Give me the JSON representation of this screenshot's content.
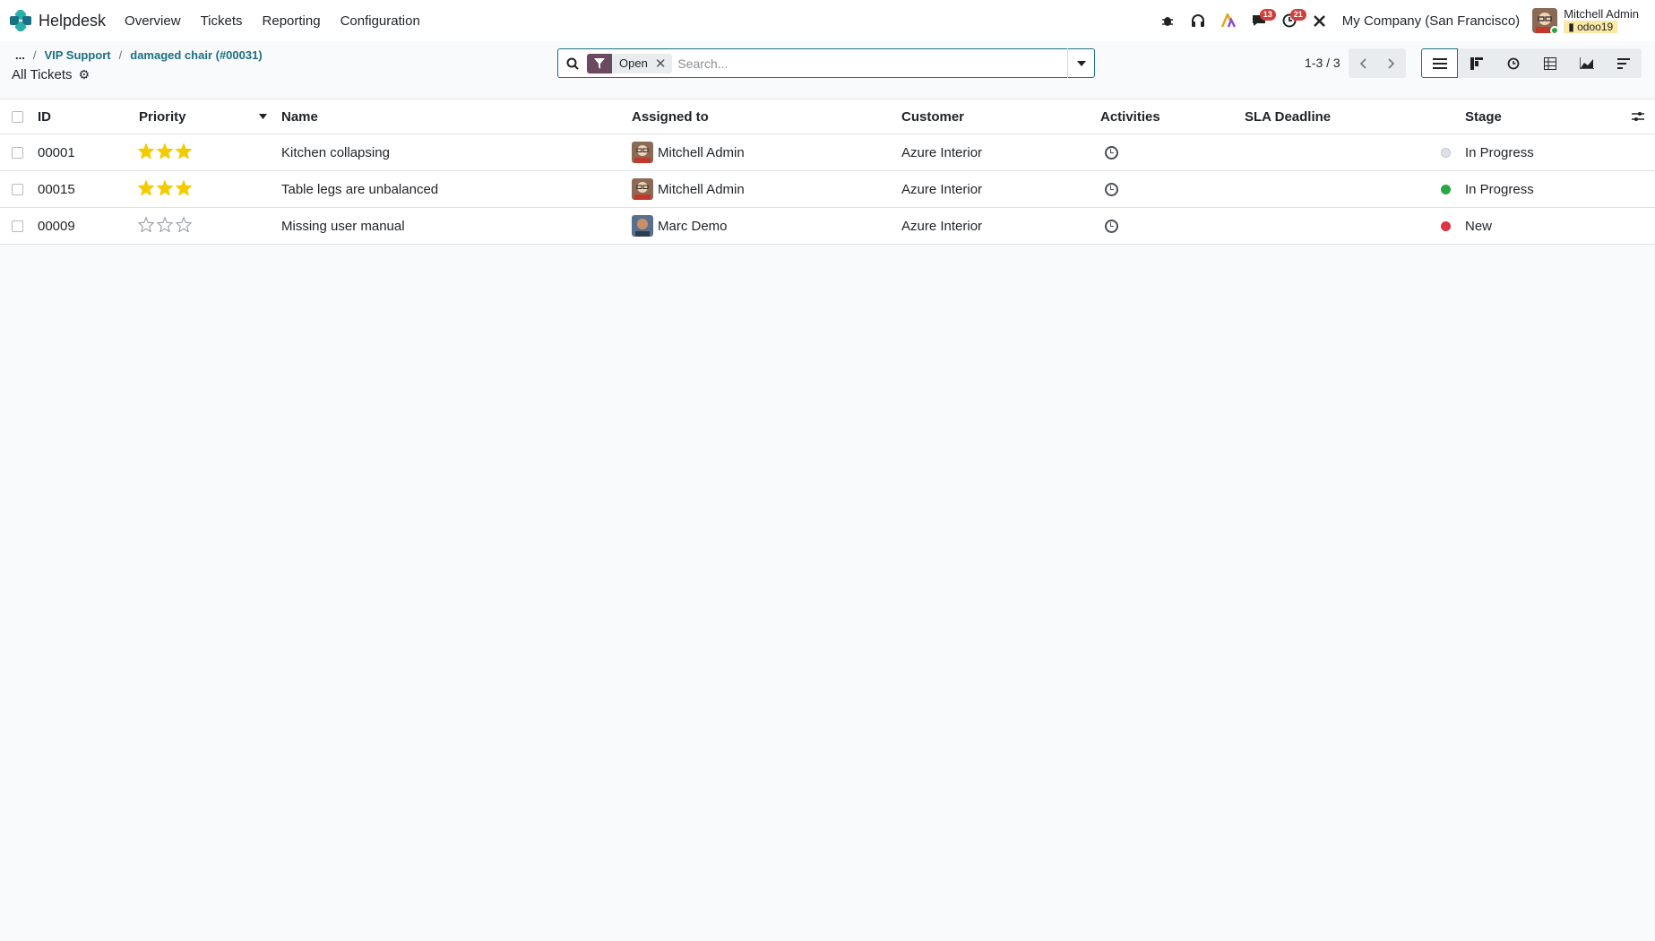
{
  "navbar": {
    "app_name": "Helpdesk",
    "menu": [
      "Overview",
      "Tickets",
      "Reporting",
      "Configuration"
    ],
    "badges": {
      "messages": "13",
      "activities": "21"
    },
    "company": "My Company (San Francisco)",
    "user_name": "Mitchell Admin",
    "db_name": "odoo19",
    "icons": [
      "bug-icon",
      "headset-icon",
      "ai-icon",
      "chat-icon",
      "clock-icon",
      "tools-icon"
    ]
  },
  "breadcrumb": {
    "ellipsis": "...",
    "items": [
      "VIP Support",
      "damaged chair (#00031)"
    ]
  },
  "page_title": "All Tickets",
  "search": {
    "facet_value": "Open",
    "placeholder": "Search..."
  },
  "pager": {
    "text": "1-3 / 3"
  },
  "views": [
    "list",
    "kanban",
    "activity",
    "pivot",
    "graph",
    "cohort"
  ],
  "colors": {
    "accent": "#1b6f82",
    "star": "#f3cc00",
    "dot_green": "#28a745",
    "dot_red": "#dc3545",
    "dot_grey": "#dee2e6"
  },
  "table": {
    "headers": {
      "id": "ID",
      "priority": "Priority",
      "name": "Name",
      "assigned": "Assigned to",
      "customer": "Customer",
      "activities": "Activities",
      "sla": "SLA Deadline",
      "stage": "Stage"
    },
    "rows": [
      {
        "id": "00001",
        "priority": 3,
        "name": "Kitchen collapsing",
        "assigned": "Mitchell Admin",
        "customer": "Azure Interior",
        "status": "grey",
        "stage": "In Progress"
      },
      {
        "id": "00015",
        "priority": 3,
        "name": "Table legs are unbalanced",
        "assigned": "Mitchell Admin",
        "customer": "Azure Interior",
        "status": "green",
        "stage": "In Progress"
      },
      {
        "id": "00009",
        "priority": 0,
        "name": "Missing user manual",
        "assigned": "Marc Demo",
        "customer": "Azure Interior",
        "status": "red",
        "stage": "New"
      }
    ]
  }
}
